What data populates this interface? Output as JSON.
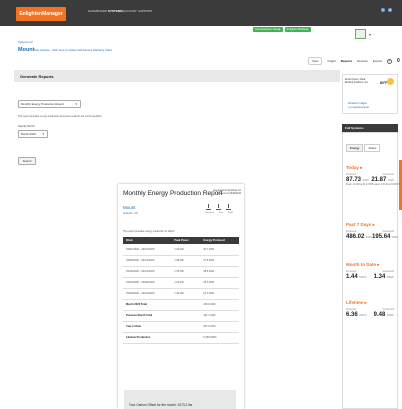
{
  "nav": {
    "brand": "EnlightenManager",
    "links": [
      "DASHBOARD",
      "SYSTEMS",
      "ACCOUNT",
      "SUPPORT"
    ],
    "icon_names": [
      "help-icon",
      "user-icon"
    ]
  },
  "header": {
    "breadcrumb": "Systems List",
    "site_name": "Mount",
    "status": "Sell Update",
    "note": "Click here to initiate Self-Service Warranty Claim",
    "green_badges": [
      "Start Enlighten Now ▶",
      "Enlighten Mobile ▶"
    ]
  },
  "view_tabs": [
    "View",
    "Graph",
    "Reports",
    "Devices",
    "Events"
  ],
  "active_tab": "Reports",
  "tab_count": "0",
  "generate": {
    "title": "Generate Reports",
    "report_type": "Monthly Energy Production Report",
    "description": "This report provides energy production and power peak for the month specified.",
    "month_label": "Specify Month:",
    "month_value": "March 2020",
    "submit": "Submit"
  },
  "report": {
    "title": "Monthly Energy Production Report",
    "generated": "Generated for Enphase Go Systems on 05/28/2020",
    "site": "Mount",
    "location": "Anaheim, CA",
    "icon_labels": [
      "Download",
      "Print",
      "Email"
    ],
    "description": "This report provides energy production for March",
    "columns": [
      "Week",
      "Peak Power",
      "Energy Produced"
    ],
    "rows": [
      [
        "03/01/2020 - 03/07/2020",
        "1.60 kW",
        "30.7 kWh"
      ],
      [
        "03/08/2020 - 03/14/2020",
        "1.58 kW",
        "37.5 kWh"
      ],
      [
        "03/15/2020 - 03/21/2020",
        "1.55 kW",
        "38.6 kWh"
      ],
      [
        "03/22/2020 - 03/28/2020",
        "1.62 kW",
        "35.0 kWh"
      ],
      [
        "03/29/2020 - 03/31/2020",
        "1.49 kW",
        "14.3 kWh"
      ]
    ],
    "summary": [
      [
        "March 2020 Total",
        "",
        "156.0 kWh"
      ],
      [
        "Previous Month Total",
        "",
        "191.1 kWh"
      ],
      [
        "Year to Date",
        "",
        "527.6 kWh"
      ],
      [
        "Lifetime Production",
        "",
        "6.359 MWh"
      ]
    ],
    "note": "Your Carbon Offset for the month: 1073.2 lbs"
  },
  "weather": {
    "line1": "Environment: Clear, Ethanol Anaheim, CA",
    "temp": "80°F",
    "line2a": "Weather Images",
    "line2b": "+1 measurements"
  },
  "full_systems": {
    "header": "Full Systems",
    "tabs": [
      "Energy",
      "Status"
    ],
    "sections": [
      {
        "title": "Today ▸",
        "produced": "87.73",
        "produced_unit": "kWh",
        "consumed": "21.87",
        "consumed_unit": "kWh",
        "foot": "Peak: 1.6 kW at 01:13 PM Latest: 1.5 kW at 04:30 PM"
      },
      {
        "title": "Past 7 Days ▸",
        "produced": "486.02",
        "produced_unit": "kWh",
        "consumed": "195.64",
        "consumed_unit": "kWh",
        "foot": ""
      },
      {
        "title": "Month to Date ▸",
        "produced": "1.44",
        "produced_unit": "MWh",
        "consumed": "1.34",
        "consumed_unit": "MWh",
        "foot": ""
      },
      {
        "title": "Lifetime ▸",
        "produced": "6.36",
        "produced_unit": "MWh",
        "consumed": "9.48",
        "consumed_unit": "MWh",
        "foot": ""
      }
    ],
    "label_produced": "Produced",
    "label_consumed": "Consumed"
  }
}
